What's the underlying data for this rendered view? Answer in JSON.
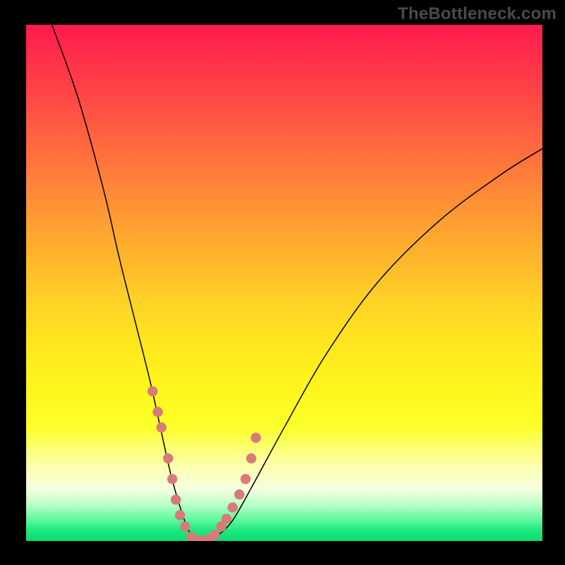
{
  "watermark": "TheBottleneck.com",
  "colors": {
    "background": "#000000",
    "marker": "#d87a7a",
    "curve": "#000000",
    "gradient_top": "#ff1a4d",
    "gradient_bottom": "#0bdc6e"
  },
  "chart_data": {
    "type": "line",
    "title": "",
    "xlabel": "",
    "ylabel": "",
    "xlim": [
      0,
      100
    ],
    "ylim": [
      0,
      100
    ],
    "grid": false,
    "legend": false,
    "series": [
      {
        "name": "bottleneck-curve",
        "x": [
          5,
          10,
          15,
          18,
          21,
          24,
          26,
          28,
          30,
          31.5,
          33,
          35,
          37,
          40,
          44,
          50,
          58,
          68,
          80,
          92,
          100
        ],
        "y": [
          100,
          86,
          68,
          55,
          43,
          31,
          22,
          13,
          6,
          2,
          0,
          0,
          1,
          4,
          11,
          22,
          36,
          50,
          62,
          71,
          76
        ]
      }
    ],
    "markers": {
      "name": "highlighted-points",
      "x": [
        24.5,
        25.5,
        26.2,
        27.5,
        28.3,
        29.0,
        29.8,
        30.8,
        32.0,
        33.5,
        35.3,
        36.5,
        37.8,
        38.8,
        40.0,
        41.3,
        42.5,
        43.6,
        44.5
      ],
      "y": [
        29,
        25,
        22,
        16,
        12,
        8,
        5,
        2.8,
        0.8,
        0.2,
        0.4,
        1.2,
        2.8,
        4.3,
        6.5,
        9.0,
        12.0,
        16.0,
        20.0
      ]
    },
    "gradient_note": "y=100 maps to red (worst), y=0 maps to green (best)"
  }
}
